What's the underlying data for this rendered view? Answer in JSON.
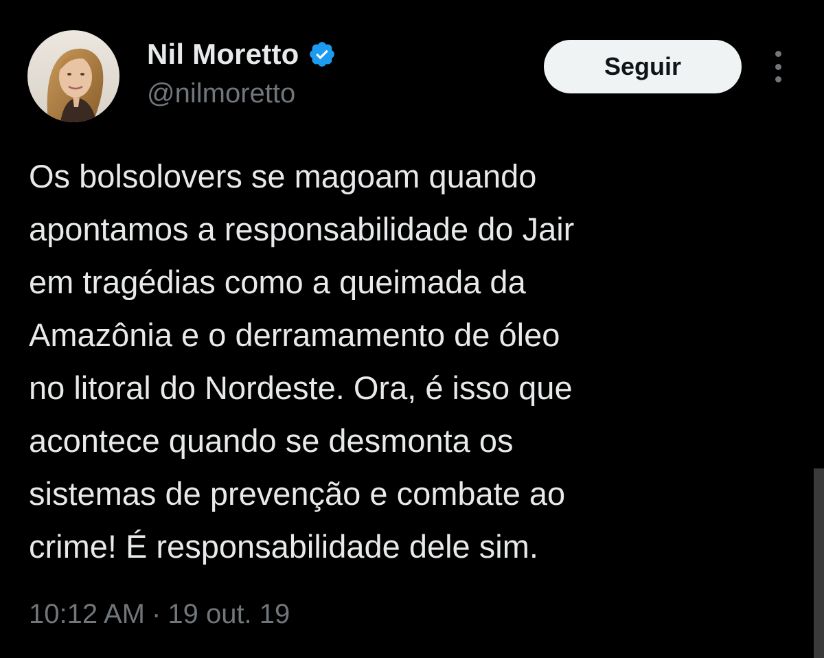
{
  "author": {
    "display_name": "Nil Moretto",
    "handle": "@nilmoretto",
    "verified_icon": "verified-badge-icon",
    "avatar_icon": "avatar-portrait"
  },
  "actions": {
    "follow_label": "Seguir",
    "more_icon": "more-options-icon"
  },
  "tweet": {
    "lines": [
      "Os bolsolovers se magoam quando",
      "apontamos a responsabilidade do Jair",
      "em tragédias como a queimada da",
      "Amazônia e o derramamento de óleo",
      "no litoral do Nordeste. Ora, é isso que",
      "acontece quando se desmonta os",
      "sistemas de prevenção e combate ao",
      "crime! É responsabilidade dele sim."
    ],
    "time": "10:12 AM",
    "separator": "·",
    "date": "19 out. 19"
  },
  "colors": {
    "background": "#000000",
    "primary_text": "#e7e9ea",
    "secondary_text": "#71767b",
    "verified": "#1d9bf0",
    "follow_button_bg": "#eff3f4"
  }
}
